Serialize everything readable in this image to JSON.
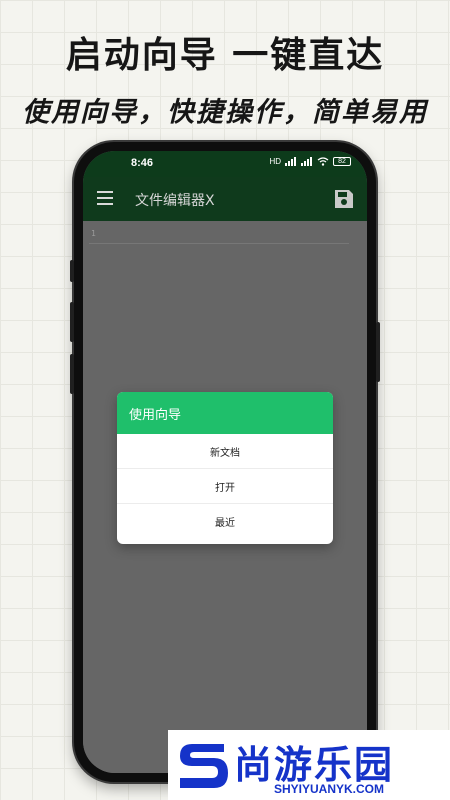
{
  "promo": {
    "headline": "启动向导  一键直达",
    "subline": "使用向导，快捷操作，简单易用"
  },
  "status_bar": {
    "time": "8:46",
    "network_label": "HD",
    "battery": "82"
  },
  "toolbar": {
    "menu_icon": "hamburger-menu-icon",
    "title": "文件编辑器X",
    "save_icon": "floppy-save-icon"
  },
  "editor": {
    "line_number": "1"
  },
  "dialog": {
    "title": "使用向导",
    "items": [
      {
        "label": "新文档"
      },
      {
        "label": "打开"
      },
      {
        "label": "最近"
      }
    ]
  },
  "watermark": {
    "name": "尚游乐园",
    "url": "SHYIYUANYK.COM"
  },
  "colors": {
    "toolbar": "#0f3a1c",
    "dialog_header": "#1fbf6b",
    "watermark": "#1533c9"
  }
}
